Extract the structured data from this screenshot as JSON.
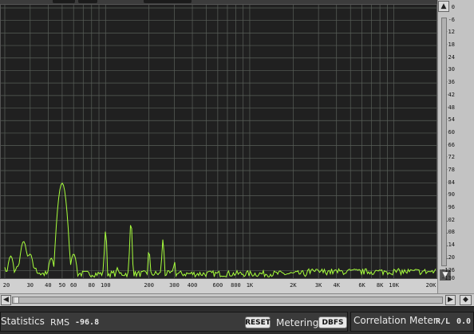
{
  "db_scale": {
    "labels": [
      "0",
      "-6",
      "-12",
      "-18",
      "-24",
      "-30",
      "-36",
      "-42",
      "-48",
      "-54",
      "-60",
      "-66",
      "-72",
      "-78",
      "-84",
      "-90",
      "-96",
      "-102",
      "-108",
      "-114",
      "-120",
      "-126",
      "-130"
    ],
    "values": [
      0,
      -6,
      -12,
      -18,
      -24,
      -30,
      -36,
      -42,
      -48,
      -54,
      -60,
      -66,
      -72,
      -78,
      -84,
      -90,
      -96,
      -102,
      -108,
      -114,
      -120,
      -126,
      -130
    ],
    "up_icon": "triangle-up-icon",
    "down_icon": "triangle-down-icon"
  },
  "freq_scale": {
    "labels": [
      "20",
      "30",
      "40",
      "50",
      "60",
      "80",
      "100",
      "200",
      "300",
      "400",
      "600",
      "800",
      "1K",
      "2K",
      "3K",
      "4K",
      "6K",
      "8K",
      "10K",
      "20K"
    ],
    "values": [
      20,
      30,
      40,
      50,
      60,
      80,
      100,
      200,
      300,
      400,
      600,
      800,
      1000,
      2000,
      3000,
      4000,
      6000,
      8000,
      10000,
      20000
    ]
  },
  "spectrum": {
    "line_color": "#a7ff3c",
    "grid_color": "#595f59",
    "background": "#202020",
    "peaks": [
      {
        "f": 22,
        "db": -119
      },
      {
        "f": 27,
        "db": -112
      },
      {
        "f": 30,
        "db": -118
      },
      {
        "f": 42,
        "db": -120
      },
      {
        "f": 50,
        "db": -84
      },
      {
        "f": 60,
        "db": -118
      },
      {
        "f": 100,
        "db": -107
      },
      {
        "f": 120,
        "db": -124
      },
      {
        "f": 150,
        "db": -103
      },
      {
        "f": 200,
        "db": -116
      },
      {
        "f": 250,
        "db": -111
      },
      {
        "f": 300,
        "db": -121
      },
      {
        "f": 3500,
        "db": -126
      },
      {
        "f": 20000,
        "db": -123
      }
    ]
  },
  "scrollbar": {
    "left_icon": "triangle-left-icon",
    "right_icon": "triangle-right-icon",
    "lr_icon": "diamond-icon"
  },
  "statistics": {
    "title": "Statistics",
    "rms_label": "RMS",
    "rms_value": "-96.8",
    "reset_label": "RESET",
    "metering_label": "Metering",
    "metering_value": "DBFS"
  },
  "correlation": {
    "title": "Correlation Meter",
    "rl_label": "R/L",
    "rl_value": "0.0"
  }
}
